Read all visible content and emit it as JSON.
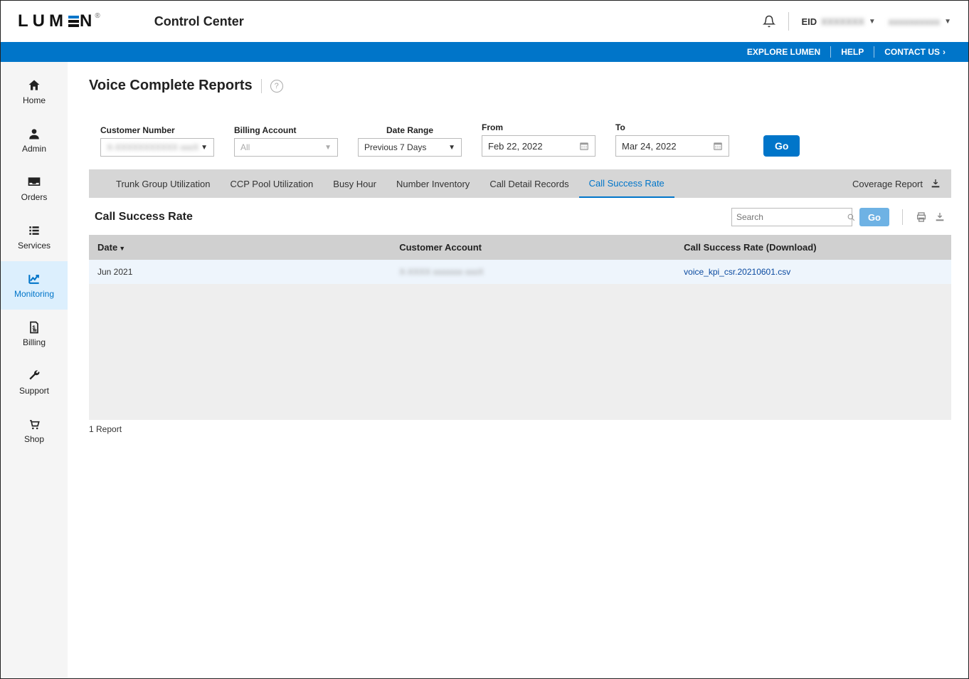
{
  "header": {
    "logo_text_left": "LUM",
    "logo_text_right": "N",
    "app_title": "Control Center",
    "eid_label": "EID",
    "eid_value": "XXXXXXX",
    "user_name": "xxxxxxxxxx"
  },
  "bluebar": {
    "explore": "EXPLORE LUMEN",
    "help": "HELP",
    "contact": "CONTACT US"
  },
  "sidebar": {
    "items": [
      {
        "label": "Home"
      },
      {
        "label": "Admin"
      },
      {
        "label": "Orders"
      },
      {
        "label": "Services"
      },
      {
        "label": "Monitoring"
      },
      {
        "label": "Billing"
      },
      {
        "label": "Support"
      },
      {
        "label": "Shop"
      }
    ]
  },
  "page": {
    "title": "Voice Complete Reports"
  },
  "filters": {
    "customer_number_label": "Customer Number",
    "customer_number_value": "X-XXXXXXXXXXX xxxX",
    "billing_account_label": "Billing Account",
    "billing_account_value": "All",
    "date_range_label": "Date Range",
    "date_range_value": "Previous 7 Days",
    "from_label": "From",
    "from_value": "Feb 22, 2022",
    "to_label": "To",
    "to_value": "Mar 24, 2022",
    "go_label": "Go"
  },
  "tabs": {
    "items": [
      "Trunk Group Utilization",
      "CCP Pool Utilization",
      "Busy Hour",
      "Number Inventory",
      "Call Detail Records",
      "Call Success Rate"
    ],
    "active_index": 5,
    "coverage_report": "Coverage Report"
  },
  "section": {
    "title": "Call Success Rate",
    "search_placeholder": "Search",
    "go_label": "Go"
  },
  "table": {
    "headers": {
      "date": "Date",
      "customer_account": "Customer Account",
      "csr_download": "Call Success Rate (Download)"
    },
    "rows": [
      {
        "date": "Jun 2021",
        "customer_account": "X-XXXX xxxxxxx xxxX",
        "download": "voice_kpi_csr.20210601.csv"
      }
    ],
    "footer": "1 Report"
  }
}
